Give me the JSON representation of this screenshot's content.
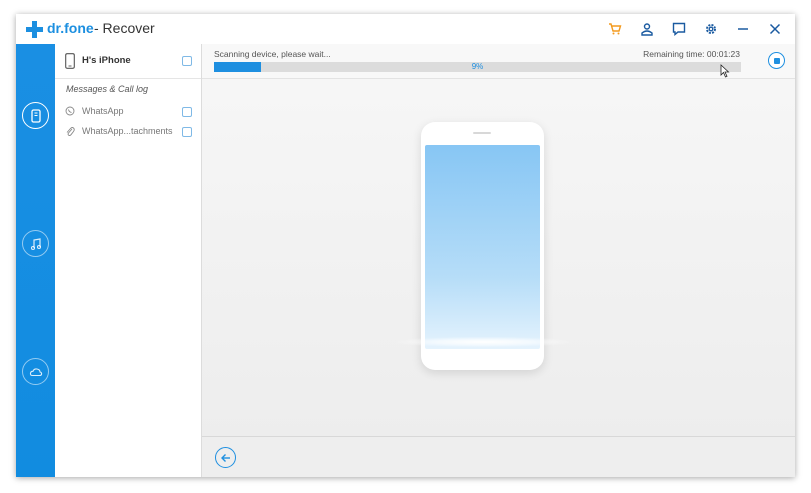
{
  "app": {
    "brand": "dr.fone",
    "title": "- Recover"
  },
  "colors": {
    "accent": "#1e8fe0",
    "cart": "#f39a1e",
    "sidebar": "#1a8fe3"
  },
  "titlebar_icons": [
    "cart-icon",
    "account-icon",
    "feedback-icon",
    "settings-icon",
    "minimize-icon",
    "close-icon"
  ],
  "leftnav": [
    "phone-recover-icon",
    "music-icon",
    "cloud-icon"
  ],
  "sidepanel": {
    "device_name": "H's iPhone",
    "section_label": "Messages & Call log",
    "items": [
      {
        "label": "WhatsApp",
        "icon": "whatsapp-icon"
      },
      {
        "label": "WhatsApp...tachments",
        "icon": "attachment-icon"
      }
    ]
  },
  "scan": {
    "status": "Scanning device, please wait...",
    "remaining": "Remaining time: 00:01:23",
    "percent_label": "9%",
    "progress": 0.09
  }
}
